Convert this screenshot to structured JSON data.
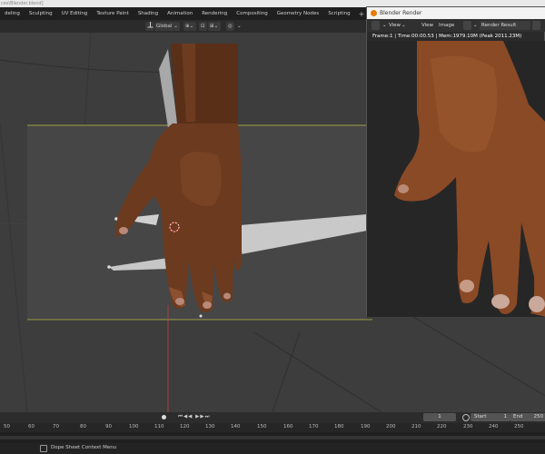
{
  "window_title": "ces\\Blender.blend]",
  "workspace_tabs": [
    "deling",
    "Sculpting",
    "UV Editing",
    "Texture Paint",
    "Shading",
    "Animation",
    "Rendering",
    "Compositing",
    "Geometry Nodes",
    "Scripting"
  ],
  "tab_add": "+",
  "viewport": {
    "orientation": "Global"
  },
  "render_window": {
    "title": "Blender Render",
    "menu_view": "View",
    "menu_view2": "View",
    "menu_image": "Image",
    "slot_label": "Render Result",
    "info": "Frame:1 | Time:00:00.53 | Mem:1979.10M (Peak 2011.23M)"
  },
  "timeline": {
    "current_frame": "1",
    "start_label": "Start",
    "start_value": "1",
    "end_label": "End",
    "end_value": "250",
    "ticks": [
      "50",
      "60",
      "70",
      "80",
      "90",
      "100",
      "110",
      "120",
      "130",
      "140",
      "150",
      "160",
      "170",
      "180",
      "190",
      "200",
      "210",
      "220",
      "230",
      "240",
      "250"
    ]
  },
  "status_bar": {
    "message": "Dope Sheet Context Menu"
  },
  "colors": {
    "accent_orange": "#e87d0d",
    "viewport_bg": "#3d3d3d",
    "camera_frame": "#bdbd4a",
    "skin": "#6b3a1f"
  }
}
